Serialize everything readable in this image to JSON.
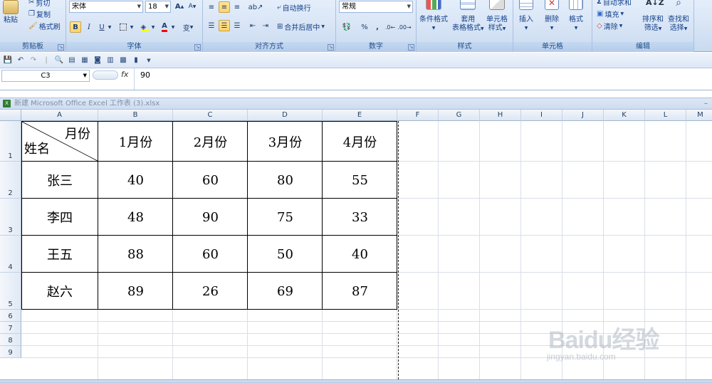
{
  "ribbon": {
    "clipboard": {
      "paste": "粘贴",
      "cut": "剪切",
      "copy": "复制",
      "format_painter": "格式刷",
      "label": "剪贴板"
    },
    "font": {
      "family": "宋体",
      "size": "18",
      "grow": "A",
      "shrink": "A",
      "bold": "B",
      "italic": "I",
      "underline": "U",
      "phonetic": "变",
      "label": "字体"
    },
    "alignment": {
      "wrap": "自动换行",
      "merge": "合并后居中",
      "label": "对齐方式"
    },
    "number": {
      "format": "常规",
      "percent": "%",
      "comma": ",",
      "label": "数字"
    },
    "styles": {
      "conditional": "条件格式",
      "format_as_table_1": "套用",
      "format_as_table_2": "表格格式",
      "cell_styles_1": "单元格",
      "cell_styles_2": "样式",
      "label": "样式"
    },
    "cells": {
      "insert": "插入",
      "delete": "删除",
      "format": "格式",
      "label": "单元格"
    },
    "editing": {
      "autosum": "自动求和",
      "fill": "填充",
      "clear": "清除",
      "sort_1": "排序和",
      "sort_2": "筛选",
      "find_1": "查找和",
      "find_2": "选择",
      "label": "编辑"
    }
  },
  "formula_bar": {
    "name_box": "C3",
    "fx": "fx",
    "value": "90"
  },
  "workbook": {
    "title": "新建 Microsoft Office Excel 工作表 (3).xlsx"
  },
  "columns": [
    "A",
    "B",
    "C",
    "D",
    "E",
    "F",
    "G",
    "H",
    "I",
    "J",
    "K",
    "L",
    "M"
  ],
  "rows": [
    "1",
    "2",
    "3",
    "4",
    "5",
    "6",
    "7",
    "8",
    "9"
  ],
  "table": {
    "header_top_right": "月份",
    "header_bottom_left": "姓名",
    "months": [
      "1月份",
      "2月份",
      "3月份",
      "4月份"
    ],
    "data": [
      {
        "name": "张三",
        "values": [
          "40",
          "60",
          "80",
          "55"
        ]
      },
      {
        "name": "李四",
        "values": [
          "48",
          "90",
          "75",
          "33"
        ]
      },
      {
        "name": "王五",
        "values": [
          "88",
          "60",
          "50",
          "40"
        ]
      },
      {
        "name": "赵六",
        "values": [
          "89",
          "26",
          "69",
          "87"
        ]
      }
    ]
  },
  "watermark": {
    "main": "Baidu经验",
    "sub": "jingyan.baidu.com"
  },
  "colors": {
    "ribbon_bg": "#d7e4f5",
    "grid_line": "#d9dee6",
    "accent": "#15428b"
  }
}
